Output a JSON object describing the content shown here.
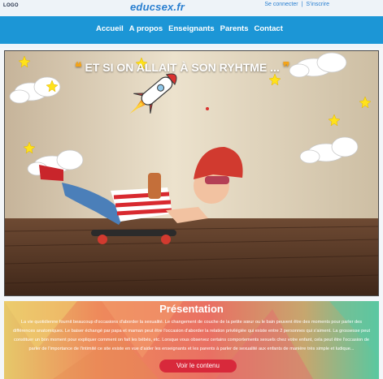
{
  "header": {
    "logo": "LOGO",
    "brand": "educsex.fr",
    "login": "Se connecter",
    "separator": "|",
    "signup": "S'inscrire"
  },
  "nav": {
    "items": [
      "Accueil",
      "A propos",
      "Enseignants",
      "Parents",
      "Contact"
    ]
  },
  "hero": {
    "title": "ET SI ON ALLAIT À SON RYHTME ...",
    "quote_open": "❝",
    "quote_close": "❞"
  },
  "presentation": {
    "title": "Présentation",
    "text": "La vie quotidienne fournit beaucoup d'occasions d'aborder la sexualité. Le changement de couche de la petite sœur ou le bain peuvent être des moments pour parler des différences anatomiques. Le baiser échangé par papa et maman peut être l'occasion d'aborder la relation privilégiée qui existe entre 2 personnes qui s'aiment. La grossesse peut constituer un bon moment pour expliquer comment on fait les bébés, etc. Lorsque vous observez certains comportements sexuels chez votre enfant, cela peut être l'occasion de parler de l'importance de l'intimité ce site existe en vue d'aider les enseignants et les parents à parler de sexualité aux enfants de manière très simple et ludique...",
    "button": "Voir le contenu"
  },
  "colors": {
    "navbar": "#1c96d6",
    "brand": "#2a7fd0",
    "button": "#d8293b",
    "quote": "#f3a319"
  }
}
